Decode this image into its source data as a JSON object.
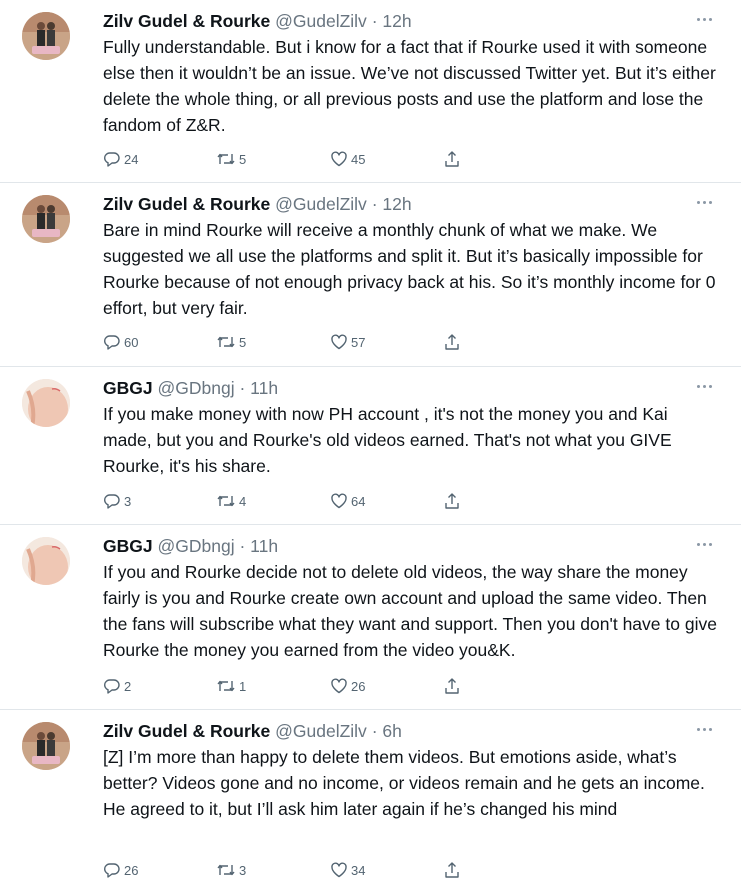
{
  "colors": {
    "text": "#0f1419",
    "muted": "#697580",
    "divider": "#e1e6ea",
    "action": "#536471"
  },
  "tweets": [
    {
      "avatar_icon": "couple-avatar",
      "name": "Zilv Gudel & Rourke",
      "handle": "@GudelZilv",
      "dot": "·",
      "time": "12h",
      "text": "Fully understandable. But i know for a fact that if Rourke used it with someone else then it wouldn’t be an issue. We’ve not discussed Twitter yet. But it’s either delete the whole thing, or all previous posts and use the platform and lose the fandom of Z&R.",
      "replies": "24",
      "retweets": "5",
      "likes": "45"
    },
    {
      "avatar_icon": "couple-avatar",
      "name": "Zilv Gudel & Rourke",
      "handle": "@GudelZilv",
      "dot": "·",
      "time": "12h",
      "text": "Bare in mind Rourke will receive a monthly chunk of what we make. We suggested we all use the platforms and split it. But it’s basically impossible for Rourke because of not enough privacy back at his. So it’s monthly income for 0 effort, but very fair.",
      "replies": "60",
      "retweets": "5",
      "likes": "57"
    },
    {
      "avatar_icon": "peach-avatar",
      "name": "GBGJ",
      "handle": "@GDbngj",
      "dot": "·",
      "time": "11h",
      "text": "If you make money with now PH account , it's not the money you and Kai made, but you and Rourke's old videos earned. That's not what you GIVE Rourke, it's his share.",
      "replies": "3",
      "retweets": "4",
      "likes": "64"
    },
    {
      "avatar_icon": "peach-avatar",
      "name": "GBGJ",
      "handle": "@GDbngj",
      "dot": "·",
      "time": "11h",
      "text": "If you and Rourke decide not to delete old videos, the way share the money fairly is you and Rourke create own account and upload the same video. Then the fans will subscribe what they want and support. Then you don't have to give Rourke the money you earned from the video you&K.",
      "replies": "2",
      "retweets": "1",
      "likes": "26"
    },
    {
      "avatar_icon": "couple-avatar",
      "name": "Zilv Gudel & Rourke",
      "handle": "@GudelZilv",
      "dot": "·",
      "time": "6h",
      "text": "[Z] I’m more than happy to delete them videos. But emotions aside, what’s better? Videos gone and no income, or videos remain and he gets an income. He agreed to it, but I’ll ask him later again if he’s changed his mind",
      "replies": "26",
      "retweets": "3",
      "likes": "34"
    }
  ]
}
